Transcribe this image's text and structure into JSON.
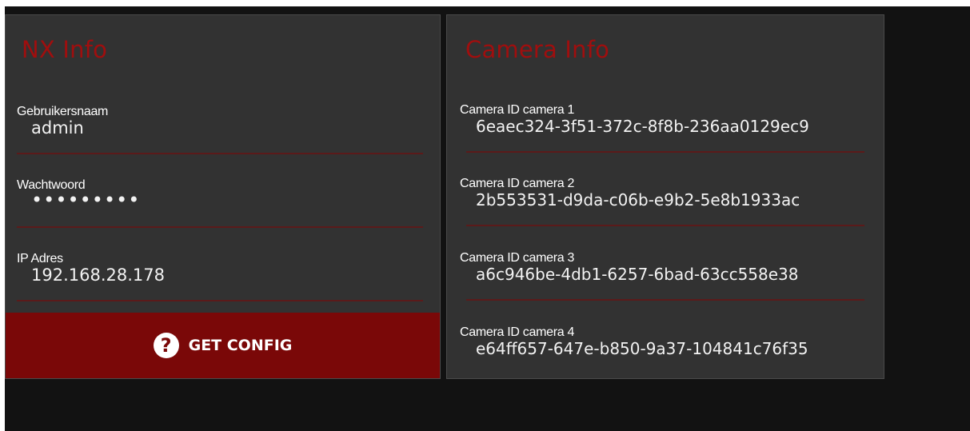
{
  "colors": {
    "background": "#121212",
    "panel": "#323232",
    "accent": "#a00e0e",
    "button": "#7a0808",
    "underline": "#5b1a1a",
    "text": "#ffffff"
  },
  "nx_info": {
    "title": "NX Info",
    "fields": [
      {
        "label": "Gebruikersnaam",
        "value": "admin"
      },
      {
        "label": "Wachtwoord",
        "value": "•••••••••"
      },
      {
        "label": "IP Adres",
        "value": "192.168.28.178"
      }
    ],
    "button": {
      "icon": "help-icon",
      "icon_glyph": "?",
      "label": "GET CONFIG"
    }
  },
  "camera_info": {
    "title": "Camera Info",
    "fields": [
      {
        "label": "Camera ID camera 1",
        "value": "6eaec324-3f51-372c-8f8b-236aa0129ec9"
      },
      {
        "label": "Camera ID camera 2",
        "value": "2b553531-d9da-c06b-e9b2-5e8b1933ac"
      },
      {
        "label": "Camera ID camera 3",
        "value": "a6c946be-4db1-6257-6bad-63cc558e38"
      },
      {
        "label": "Camera ID camera 4",
        "value": "e64ff657-647e-b850-9a37-104841c76f35"
      }
    ]
  }
}
